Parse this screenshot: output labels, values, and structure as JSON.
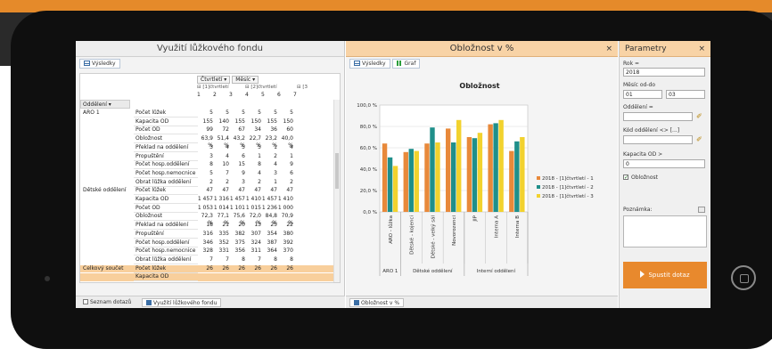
{
  "left": {
    "title": "Využití lůžkového fondu",
    "subtab": "Výsledky",
    "btn_quarter": "Čtvrtletí ▾",
    "btn_month": "Měsíc ▾",
    "quarters": [
      "⊟ [1]čtvrtletí",
      "⊟ [2]čtvrtletí",
      "⊟ [3"
    ],
    "months": [
      "1",
      "2",
      "3",
      "4",
      "5",
      "6",
      "7"
    ],
    "dept_header": "Oddělení ▾",
    "rows": [
      {
        "dep": "ARO 1",
        "met": "Počet lůžek",
        "vals": [
          "5",
          "5",
          "5",
          "5",
          "5",
          "5"
        ]
      },
      {
        "dep": "",
        "met": "Kapacita OD",
        "vals": [
          "155",
          "140",
          "155",
          "150",
          "155",
          "150"
        ]
      },
      {
        "dep": "",
        "met": "Počet OD",
        "vals": [
          "99",
          "72",
          "67",
          "34",
          "36",
          "60"
        ]
      },
      {
        "dep": "",
        "met": "Obložnost",
        "vals": [
          "63,9 %",
          "51,4 %",
          "43,2 %",
          "22,7 %",
          "23,2 %",
          "40,0 %"
        ]
      },
      {
        "dep": "",
        "met": "Překlad na oddělení",
        "vals": [
          "3",
          "4",
          "5",
          "5",
          "1",
          "4"
        ]
      },
      {
        "dep": "",
        "met": "Propuštění",
        "vals": [
          "3",
          "4",
          "6",
          "1",
          "2",
          "1"
        ]
      },
      {
        "dep": "",
        "met": "Počet hosp.oddělení",
        "vals": [
          "8",
          "10",
          "15",
          "8",
          "4",
          "9"
        ]
      },
      {
        "dep": "",
        "met": "Počet hosp.nemocnice",
        "vals": [
          "5",
          "7",
          "9",
          "4",
          "3",
          "6"
        ]
      },
      {
        "dep": "",
        "met": "Obrat lůžka oddělení",
        "vals": [
          "2",
          "2",
          "3",
          "2",
          "1",
          "2"
        ]
      },
      {
        "dep": "Dětské oddělení",
        "met": "Počet lůžek",
        "vals": [
          "47",
          "47",
          "47",
          "47",
          "47",
          "47"
        ]
      },
      {
        "dep": "",
        "met": "Kapacita OD",
        "vals": [
          "1 457",
          "1 316",
          "1 457",
          "1 410",
          "1 457",
          "1 410"
        ]
      },
      {
        "dep": "",
        "met": "Počet OD",
        "vals": [
          "1 053",
          "1 014",
          "1 101",
          "1 015",
          "1 236",
          "1 000"
        ]
      },
      {
        "dep": "",
        "met": "Obložnost",
        "vals": [
          "72,3 %",
          "77,1 %",
          "75,6 %",
          "72,0 %",
          "84,8 %",
          "70,9 %"
        ]
      },
      {
        "dep": "",
        "met": "Překlad na oddělení",
        "vals": [
          "18",
          "21",
          "20",
          "13",
          "25",
          "22"
        ]
      },
      {
        "dep": "",
        "met": "Propuštění",
        "vals": [
          "316",
          "335",
          "382",
          "307",
          "354",
          "380"
        ]
      },
      {
        "dep": "",
        "met": "Počet hosp.oddělení",
        "vals": [
          "346",
          "352",
          "375",
          "324",
          "387",
          "392"
        ]
      },
      {
        "dep": "",
        "met": "Počet hosp.nemocnice",
        "vals": [
          "328",
          "331",
          "356",
          "311",
          "364",
          "370"
        ]
      },
      {
        "dep": "",
        "met": "Obrat lůžka oddělení",
        "vals": [
          "7",
          "7",
          "8",
          "7",
          "8",
          "8"
        ]
      },
      {
        "dep": "Celkový součet",
        "met": "Počet lůžek",
        "vals": [
          "26",
          "26",
          "26",
          "26",
          "26",
          "26"
        ],
        "total": true
      },
      {
        "dep": "",
        "met": "Kapacita OD",
        "vals": [
          "",
          "",
          "",
          "",
          "",
          ""
        ],
        "total": true
      }
    ],
    "bottom_tabs": [
      "Seznam dotazů",
      "Využití lůžkového fondu"
    ]
  },
  "middle": {
    "title": "Obložnost v %",
    "subtab_results": "Výsledky",
    "subtab_chart": "Graf",
    "bottom_tab": "Obložnost v %"
  },
  "right": {
    "title": "Parametry",
    "year_label": "Rok =",
    "year_value": "2018",
    "month_label": "Měsíc od-do",
    "month_from": "01",
    "month_to": "03",
    "dept_label": "Oddělení =",
    "dept_code_label": "Kód oddělení <> [...]",
    "capacity_label": "Kapacita OD >",
    "capacity_value": "0",
    "occupancy_check_label": "Obložnost",
    "note_label": "Poznámka:",
    "run_label": "Spustit dotaz"
  },
  "chart_data": {
    "type": "bar",
    "title": "Obložnost",
    "categories": [
      "ARO - lůžka",
      "Dětské - kojenci",
      "Dětské - velký sál",
      "Novorozenci",
      "JIP",
      "Interna A",
      "Interna B"
    ],
    "groups": [
      {
        "label": "ARO 1",
        "span": 1
      },
      {
        "label": "Dětské oddělení",
        "span": 3
      },
      {
        "label": "Interní oddělení",
        "span": 3
      }
    ],
    "series": [
      {
        "name": "2018 - [1]čtvrtletí - 1",
        "color": "#e8893a",
        "values": [
          64,
          56,
          64,
          78,
          70,
          82,
          57
        ]
      },
      {
        "name": "2018 - [1]čtvrtletí - 2",
        "color": "#1f8f8a",
        "values": [
          51,
          59,
          79,
          65,
          69,
          83,
          66
        ]
      },
      {
        "name": "2018 - [1]čtvrtletí - 3",
        "color": "#f2d22e",
        "values": [
          43,
          57,
          65,
          86,
          74,
          86,
          70
        ]
      }
    ],
    "ylim": [
      0,
      100
    ],
    "yticks": [
      "0,0 %",
      "20,0 %",
      "40,0 %",
      "60,0 %",
      "80,0 %",
      "100,0 %"
    ],
    "legend": "right",
    "grid": true
  }
}
